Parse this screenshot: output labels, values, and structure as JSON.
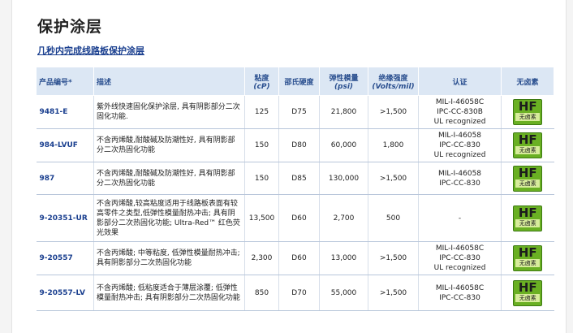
{
  "page": {
    "title": "保护涂层",
    "link_text": "几秒内完成线路板保护涂层"
  },
  "table": {
    "headers": {
      "part": "产品编号*",
      "desc": "描述",
      "viscosity": "粘度",
      "viscosity_unit": "(cP)",
      "hardness": "邵氏硬度",
      "modulus": "弹性模量",
      "modulus_unit": "(psi)",
      "dielectric": "绝缘强度",
      "dielectric_unit": "(Volts/mil)",
      "cert": "认证",
      "hf": "无卤素"
    },
    "rows": [
      {
        "part": "9481-E",
        "desc": "紫外线快速固化保护涂层, 具有阴影部分二次固化功能.",
        "viscosity": "125",
        "hardness": "D75",
        "modulus": "21,800",
        "dielectric": ">1,500",
        "cert": [
          "MIL-I-46058C",
          "IPC-CC-830B",
          "UL recognized"
        ],
        "hf_big": "HF",
        "hf_small": "无卤素"
      },
      {
        "part": "984-LVUF",
        "desc": "不含丙烯酸,耐酸碱及防潮性好, 具有阴影部分二次热固化功能",
        "viscosity": "150",
        "hardness": "D80",
        "modulus": "60,000",
        "dielectric": "1,800",
        "cert": [
          "MIL-I-46058",
          "IPC-CC-830",
          "UL recognized"
        ],
        "hf_big": "HF",
        "hf_small": "无卤素"
      },
      {
        "part": "987",
        "desc": "不含丙烯酸,耐酸碱及防潮性好, 具有阴影部分二次热固化功能",
        "viscosity": "150",
        "hardness": "D85",
        "modulus": "130,000",
        "dielectric": ">1,500",
        "cert": [
          "MIL-I-46058",
          "IPC-CC-830"
        ],
        "hf_big": "HF",
        "hf_small": "无卤素"
      },
      {
        "part": "9-20351-UR",
        "desc": "不含丙烯酸,较高粘度适用于线路板表面有较高零件之类型,低弹性模量耐热冲击; 具有阴影部分二次热固化功能; Ultra-Red™ 红色荧光效果",
        "viscosity": "13,500",
        "hardness": "D60",
        "modulus": "2,700",
        "dielectric": "500",
        "cert": [
          "-"
        ],
        "hf_big": "HF",
        "hf_small": "无卤素"
      },
      {
        "part": "9-20557",
        "desc": "不含丙烯酸; 中等粘度, 低弹性模量耐热冲击; 具有阴影部分二次热固化功能",
        "viscosity": "2,300",
        "hardness": "D60",
        "modulus": "13,000",
        "dielectric": ">1,500",
        "cert": [
          "MIL-I-46058C",
          "IPC-CC-830",
          "UL recognized"
        ],
        "hf_big": "HF",
        "hf_small": "无卤素"
      },
      {
        "part": "9-20557-LV",
        "desc": "不含丙烯酸; 低粘度适合于薄层涂覆; 低弹性模量耐热冲击; 具有阴影部分二次热固化功能",
        "viscosity": "850",
        "hardness": "D70",
        "modulus": "55,000",
        "dielectric": ">1,500",
        "cert": [
          "MIL-I-46058C",
          "IPC-CC-830"
        ],
        "hf_big": "HF",
        "hf_small": "无卤素"
      }
    ]
  },
  "colors": {
    "header_bg": "#dce7f4",
    "header_text": "#2a4f8f",
    "link": "#1a3f8f",
    "hf_badge": "#6ab023"
  }
}
